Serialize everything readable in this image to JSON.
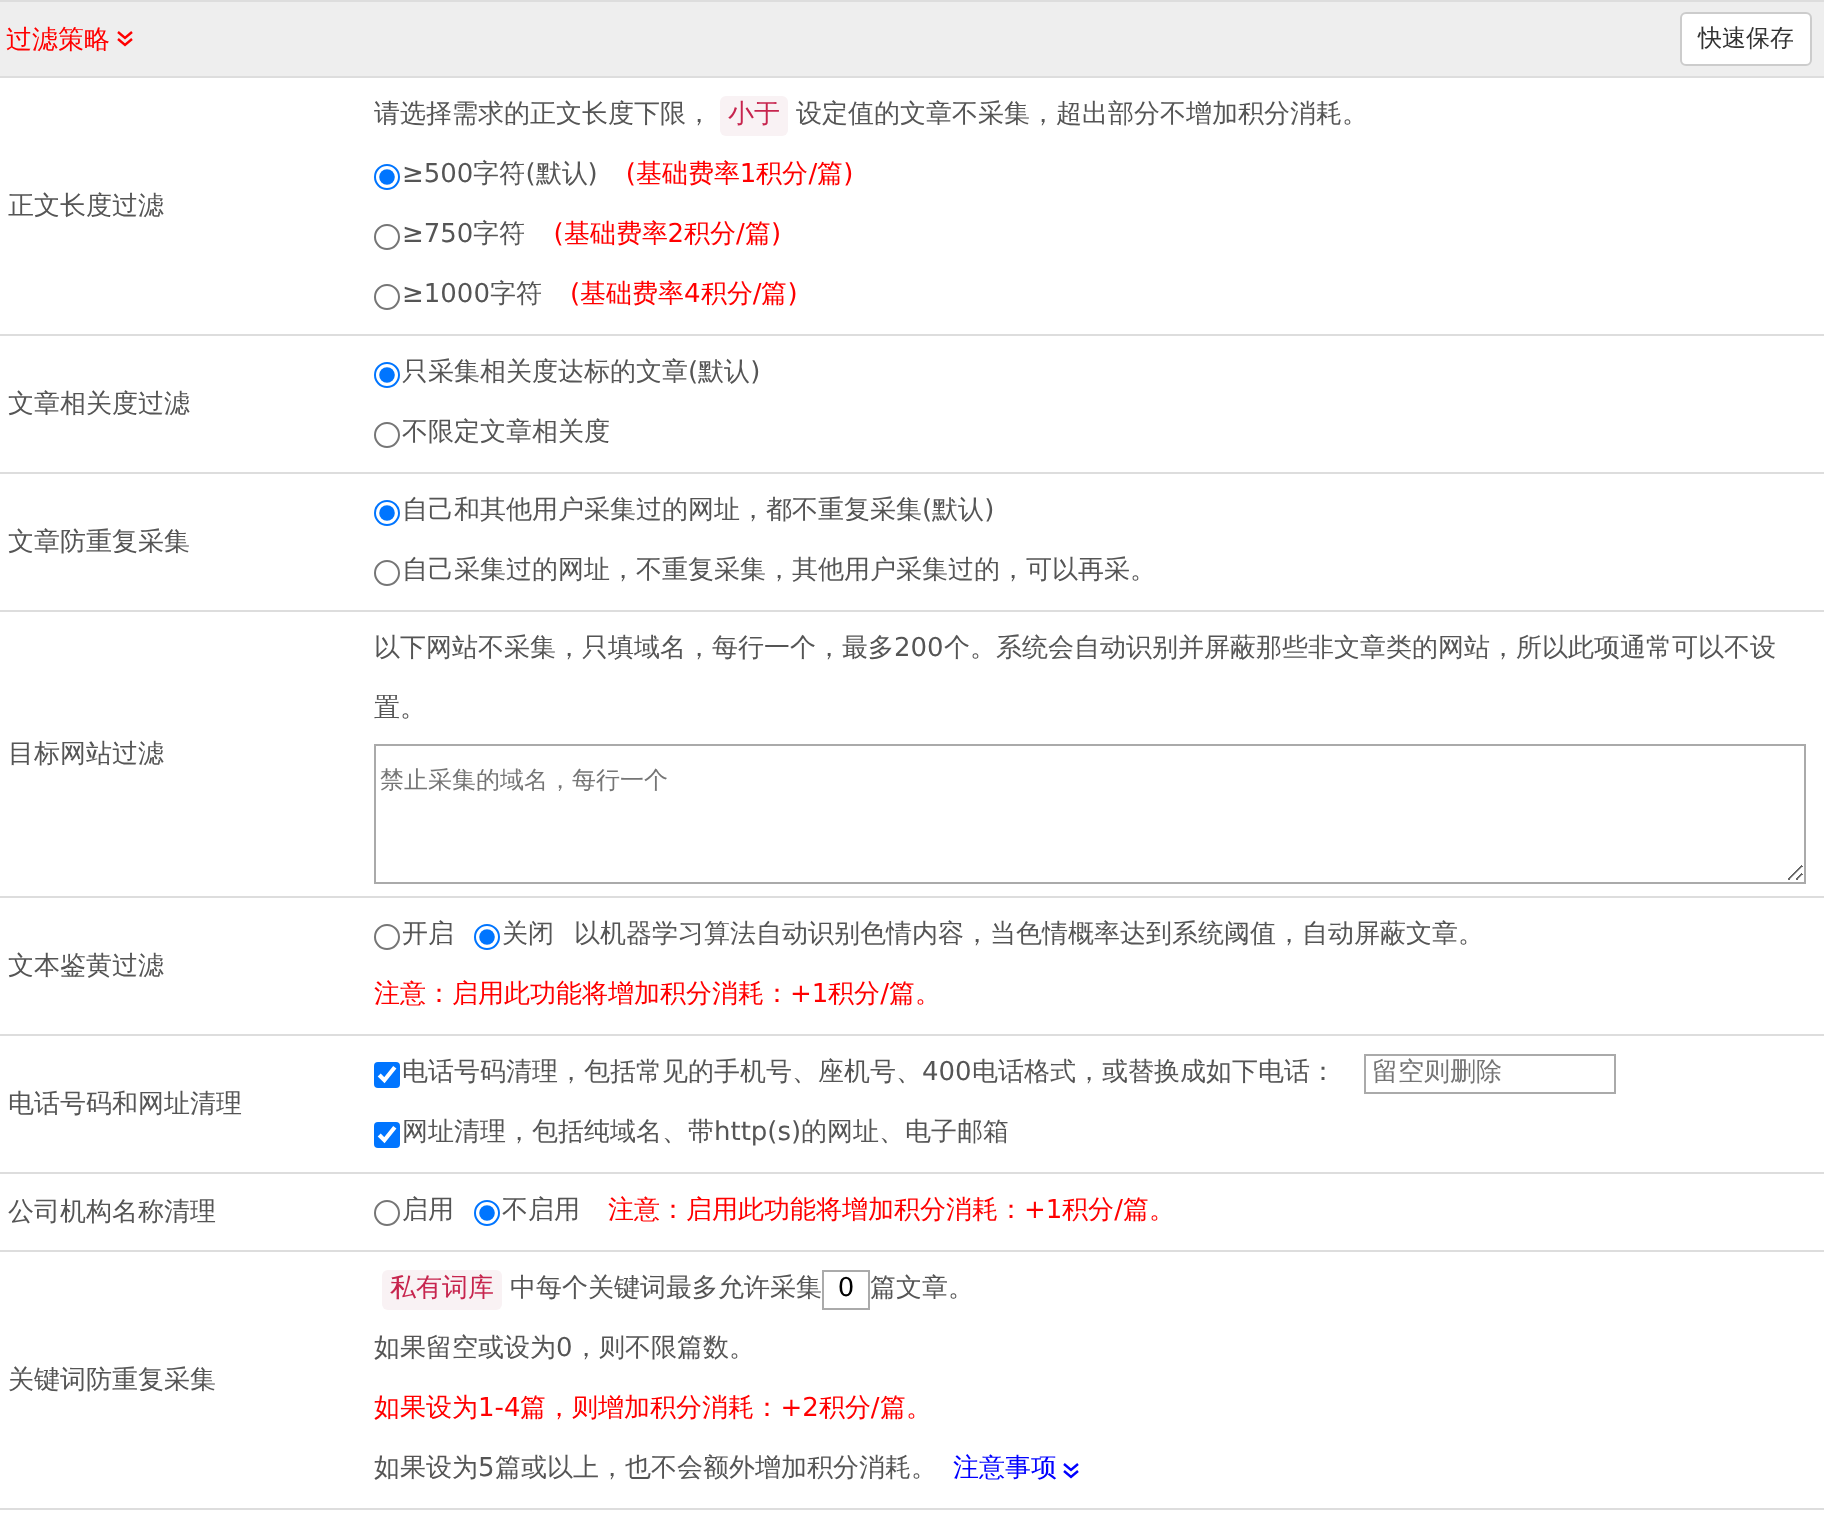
{
  "header": {
    "title": "过滤策略",
    "save_button": "快速保存"
  },
  "sections": [
    {
      "label": "正文长度过滤",
      "lines": [
        [
          {
            "kind": "text",
            "text": "请选择需求的正文长度下限，"
          },
          {
            "kind": "tag",
            "text": "小于"
          },
          {
            "kind": "text",
            "text": "设定值的文章不采集，超出部分不增加积分消耗。"
          }
        ],
        [
          {
            "kind": "radio",
            "label": "≥500字符(默认)",
            "selected": true
          },
          {
            "kind": "warn",
            "text": "(基础费率1积分/篇)"
          }
        ],
        [
          {
            "kind": "radio",
            "label": "≥750字符",
            "selected": false
          },
          {
            "kind": "warn",
            "text": "(基础费率2积分/篇)"
          }
        ],
        [
          {
            "kind": "radio",
            "label": "≥1000字符",
            "selected": false
          },
          {
            "kind": "warn",
            "text": "(基础费率4积分/篇)"
          }
        ]
      ]
    },
    {
      "label": "文章相关度过滤",
      "lines": [
        [
          {
            "kind": "radio",
            "label": "只采集相关度达标的文章(默认)",
            "selected": true
          }
        ],
        [
          {
            "kind": "radio",
            "label": "不限定文章相关度",
            "selected": false
          }
        ]
      ]
    },
    {
      "label": "文章防重复采集",
      "lines": [
        [
          {
            "kind": "radio",
            "label": "自己和其他用户采集过的网址，都不重复采集(默认)",
            "selected": true
          }
        ],
        [
          {
            "kind": "radio",
            "label": "自己采集过的网址，不重复采集，其他用户采集过的，可以再采。",
            "selected": false
          }
        ]
      ]
    },
    {
      "label": "目标网站过滤",
      "lines": [
        [
          {
            "kind": "text",
            "text": "以下网站不采集，只填域名，每行一个，最多200个。系统会自动识别并屏蔽那些非文章类的网站，所以此项通常可以不设置。"
          }
        ],
        [
          {
            "kind": "textarea",
            "placeholder": "禁止采集的域名，每行一个"
          }
        ]
      ]
    },
    {
      "label": "文本鉴黄过滤",
      "lines": [
        [
          {
            "kind": "radio",
            "label": "开启",
            "selected": false
          },
          {
            "kind": "radio",
            "label": "关闭",
            "selected": true
          },
          {
            "kind": "text",
            "text": "以机器学习算法自动识别色情内容，当色情概率达到系统阈值，自动屏蔽文章。"
          }
        ],
        [
          {
            "kind": "warn",
            "text": "注意：启用此功能将增加积分消耗：+1积分/篇。"
          }
        ]
      ]
    },
    {
      "label": "电话号码和网址清理",
      "lines": [
        [
          {
            "kind": "checkbox",
            "label": "电话号码清理，包括常见的手机号、座机号、400电话格式，或替换成如下电话：",
            "checked": true
          },
          {
            "kind": "input",
            "placeholder": "留空则删除"
          }
        ],
        [
          {
            "kind": "checkbox",
            "label": "网址清理，包括纯域名、带http(s)的网址、电子邮箱",
            "checked": true
          }
        ]
      ]
    },
    {
      "label": "公司机构名称清理",
      "lines": [
        [
          {
            "kind": "radio",
            "label": "启用",
            "selected": false
          },
          {
            "kind": "radio",
            "label": "不启用",
            "selected": true
          },
          {
            "kind": "warn",
            "text": "注意：启用此功能将增加积分消耗：+1积分/篇。"
          }
        ]
      ]
    },
    {
      "label": "关键词防重复采集",
      "lines": [
        [
          {
            "kind": "tag",
            "text": "私有词库"
          },
          {
            "kind": "text",
            "text": "中每个关键词最多允许采集"
          },
          {
            "kind": "number",
            "value": "0"
          },
          {
            "kind": "text",
            "text": "篇文章。"
          }
        ],
        [
          {
            "kind": "text",
            "text": "如果留空或设为0，则不限篇数。"
          }
        ],
        [
          {
            "kind": "warn",
            "text": "如果设为1-4篇，则增加积分消耗：+2积分/篇。"
          }
        ],
        [
          {
            "kind": "text",
            "text": "如果设为5篇或以上，也不会额外增加积分消耗。"
          },
          {
            "kind": "link",
            "text": "注意事项"
          }
        ]
      ]
    }
  ]
}
